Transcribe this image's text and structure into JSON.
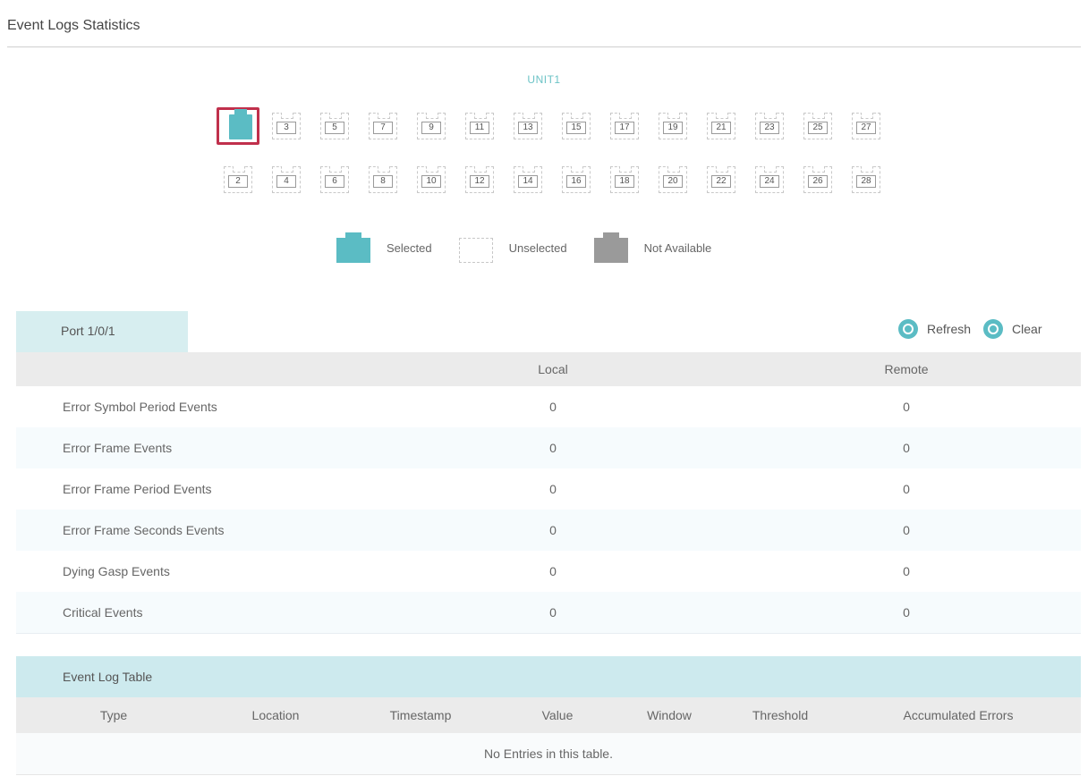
{
  "page": {
    "title": "Event Logs Statistics"
  },
  "unit": {
    "label": "UNIT1"
  },
  "ports": {
    "top_row": [
      "1",
      "3",
      "5",
      "7",
      "9",
      "11",
      "13",
      "15",
      "17",
      "19",
      "21",
      "23",
      "25",
      "27"
    ],
    "bottom_row": [
      "2",
      "4",
      "6",
      "8",
      "10",
      "12",
      "14",
      "16",
      "18",
      "20",
      "22",
      "24",
      "26",
      "28"
    ],
    "selected": "1"
  },
  "legend": {
    "selected": "Selected",
    "unselected": "Unselected",
    "not_available": "Not Available"
  },
  "colors": {
    "accent": "#5bbcc4",
    "selection_border": "#c0304c",
    "not_available": "#9a9a9a"
  },
  "port_tab": {
    "label": "Port 1/0/1"
  },
  "actions": {
    "refresh": "Refresh",
    "clear": "Clear"
  },
  "stats": {
    "columns": [
      "",
      "Local",
      "Remote"
    ],
    "rows": [
      {
        "name": "Error Symbol Period Events",
        "local": "0",
        "remote": "0"
      },
      {
        "name": "Error Frame Events",
        "local": "0",
        "remote": "0"
      },
      {
        "name": "Error Frame Period Events",
        "local": "0",
        "remote": "0"
      },
      {
        "name": "Error Frame Seconds Events",
        "local": "0",
        "remote": "0"
      },
      {
        "name": "Dying Gasp Events",
        "local": "0",
        "remote": "0"
      },
      {
        "name": "Critical Events",
        "local": "0",
        "remote": "0"
      }
    ]
  },
  "event_log": {
    "title": "Event Log Table",
    "columns": [
      "Type",
      "Location",
      "Timestamp",
      "Value",
      "Window",
      "Threshold",
      "Accumulated Errors"
    ],
    "empty_text": "No Entries in this table."
  }
}
